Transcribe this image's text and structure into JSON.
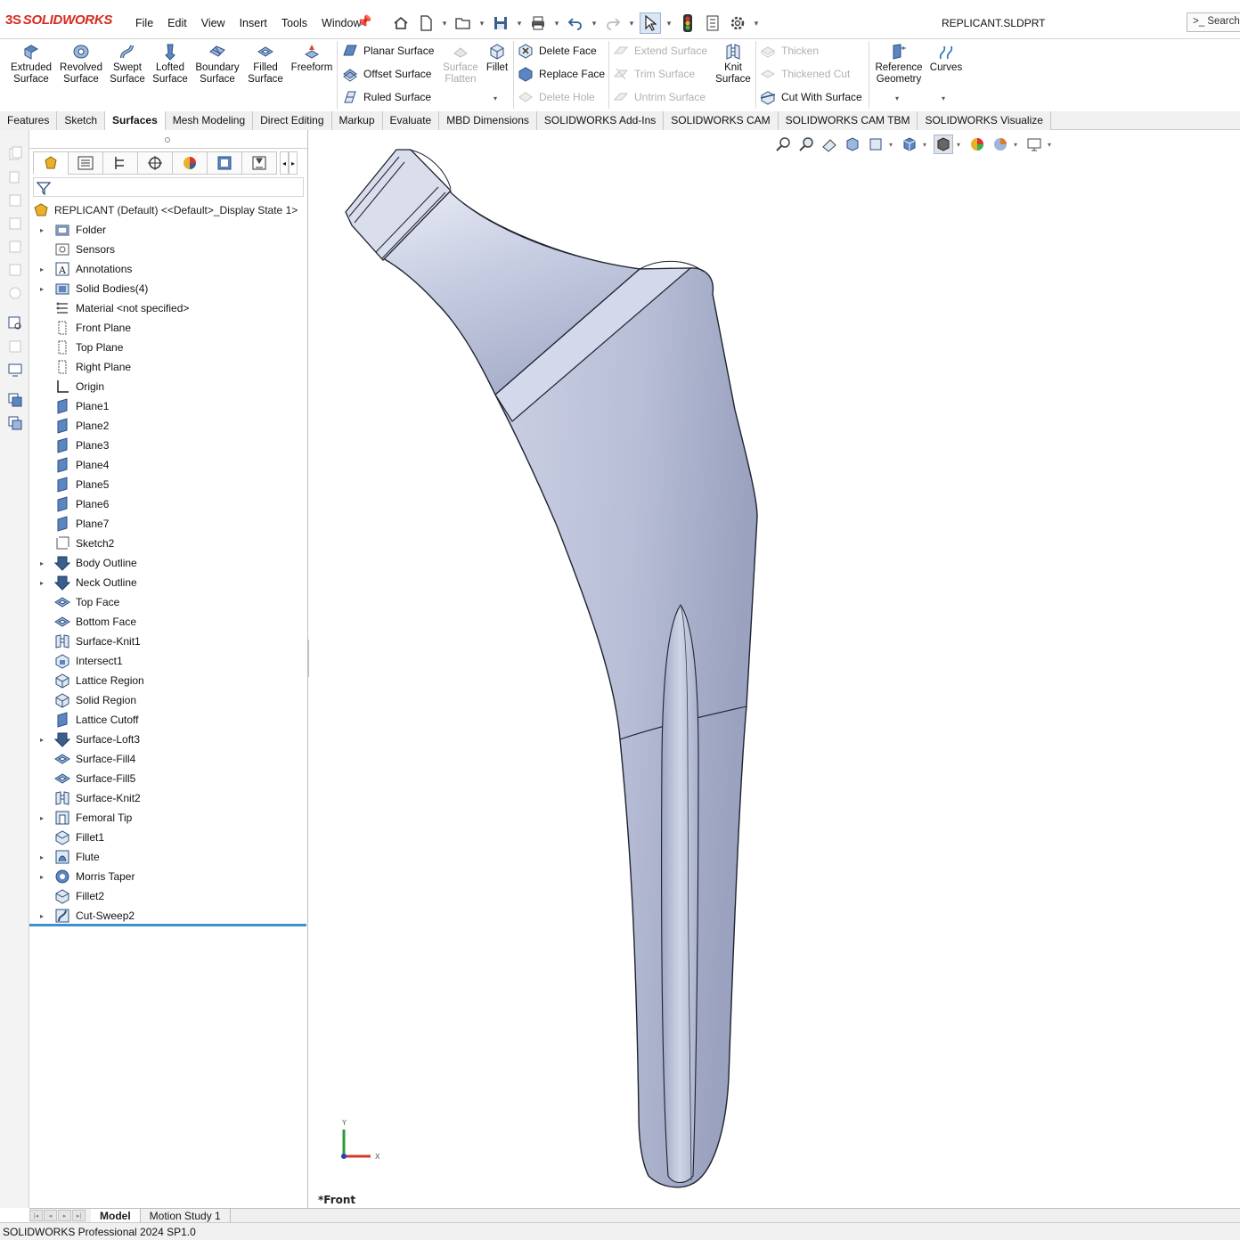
{
  "app": {
    "brand": "SOLIDWORKS",
    "brand_prefix": "3S",
    "document_title": "REPLICANT.SLDPRT",
    "search_label": "Search"
  },
  "menu": [
    "File",
    "Edit",
    "View",
    "Insert",
    "Tools",
    "Window"
  ],
  "command_manager": {
    "big_buttons": [
      {
        "label": "Extruded Surface",
        "line1": "Extruded",
        "line2": "Surface",
        "icon": "extruded-surface-icon"
      },
      {
        "label": "Revolved Surface",
        "line1": "Revolved",
        "line2": "Surface",
        "icon": "revolved-surface-icon"
      },
      {
        "label": "Swept Surface",
        "line1": "Swept",
        "line2": "Surface",
        "icon": "swept-surface-icon"
      },
      {
        "label": "Lofted Surface",
        "line1": "Lofted",
        "line2": "Surface",
        "icon": "lofted-surface-icon"
      },
      {
        "label": "Boundary Surface",
        "line1": "Boundary",
        "line2": "Surface",
        "icon": "boundary-surface-icon"
      },
      {
        "label": "Filled Surface",
        "line1": "Filled",
        "line2": "Surface",
        "icon": "filled-surface-icon"
      },
      {
        "label": "Freeform",
        "line1": "Freeform",
        "line2": "",
        "icon": "freeform-icon"
      }
    ],
    "group1": [
      "Planar Surface",
      "Offset Surface",
      "Ruled Surface"
    ],
    "surface_flatten": {
      "line1": "Surface",
      "line2": "Flatten",
      "enabled": false
    },
    "fillet": {
      "line1": "Fillet"
    },
    "group2": [
      {
        "label": "Delete Face",
        "enabled": true
      },
      {
        "label": "Replace Face",
        "enabled": true
      },
      {
        "label": "Delete Hole",
        "enabled": false
      }
    ],
    "group3": [
      {
        "label": "Extend Surface",
        "enabled": false
      },
      {
        "label": "Trim Surface",
        "enabled": false
      },
      {
        "label": "Untrim Surface",
        "enabled": false
      }
    ],
    "knit_surface": {
      "line1": "Knit",
      "line2": "Surface"
    },
    "group4": [
      {
        "label": "Thicken",
        "enabled": false
      },
      {
        "label": "Thickened Cut",
        "enabled": false
      },
      {
        "label": "Cut With Surface",
        "enabled": true
      }
    ],
    "reference_geometry": {
      "line1": "Reference",
      "line2": "Geometry"
    },
    "curves": {
      "line1": "Curves"
    }
  },
  "tabs": [
    {
      "label": "Features",
      "active": false
    },
    {
      "label": "Sketch",
      "active": false
    },
    {
      "label": "Surfaces",
      "active": true
    },
    {
      "label": "Mesh Modeling",
      "active": false
    },
    {
      "label": "Direct Editing",
      "active": false
    },
    {
      "label": "Markup",
      "active": false
    },
    {
      "label": "Evaluate",
      "active": false
    },
    {
      "label": "MBD Dimensions",
      "active": false
    },
    {
      "label": "SOLIDWORKS Add-Ins",
      "active": false
    },
    {
      "label": "SOLIDWORKS CAM",
      "active": false
    },
    {
      "label": "SOLIDWORKS CAM TBM",
      "active": false
    },
    {
      "label": "SOLIDWORKS Visualize",
      "active": false
    }
  ],
  "feature_tree": {
    "root": "REPLICANT (Default) <<Default>_Display State 1>",
    "items": [
      {
        "label": "Folder",
        "expandable": true,
        "icon": "folder-icon"
      },
      {
        "label": "Sensors",
        "expandable": false,
        "icon": "sensors-icon"
      },
      {
        "label": "Annotations",
        "expandable": true,
        "icon": "annotations-icon"
      },
      {
        "label": "Solid Bodies(4)",
        "expandable": true,
        "icon": "solid-bodies-icon"
      },
      {
        "label": "Material <not specified>",
        "expandable": false,
        "icon": "material-icon"
      },
      {
        "label": "Front Plane",
        "expandable": false,
        "icon": "plane-icon"
      },
      {
        "label": "Top Plane",
        "expandable": false,
        "icon": "plane-icon"
      },
      {
        "label": "Right Plane",
        "expandable": false,
        "icon": "plane-icon"
      },
      {
        "label": "Origin",
        "expandable": false,
        "icon": "origin-icon"
      },
      {
        "label": "Plane1",
        "expandable": false,
        "icon": "ref-plane-icon"
      },
      {
        "label": "Plane2",
        "expandable": false,
        "icon": "ref-plane-icon"
      },
      {
        "label": "Plane3",
        "expandable": false,
        "icon": "ref-plane-icon"
      },
      {
        "label": "Plane4",
        "expandable": false,
        "icon": "ref-plane-icon"
      },
      {
        "label": "Plane5",
        "expandable": false,
        "icon": "ref-plane-icon"
      },
      {
        "label": "Plane6",
        "expandable": false,
        "icon": "ref-plane-icon"
      },
      {
        "label": "Plane7",
        "expandable": false,
        "icon": "ref-plane-icon"
      },
      {
        "label": "Sketch2",
        "expandable": false,
        "icon": "sketch-icon"
      },
      {
        "label": "Body Outline",
        "expandable": true,
        "icon": "folder-down-icon"
      },
      {
        "label": "Neck Outline",
        "expandable": true,
        "icon": "folder-down-icon"
      },
      {
        "label": "Top Face",
        "expandable": false,
        "icon": "fill-surface-icon"
      },
      {
        "label": "Bottom Face",
        "expandable": false,
        "icon": "fill-surface-icon"
      },
      {
        "label": "Surface-Knit1",
        "expandable": false,
        "icon": "knit-icon"
      },
      {
        "label": "Intersect1",
        "expandable": false,
        "icon": "intersect-icon"
      },
      {
        "label": "Lattice Region",
        "expandable": false,
        "icon": "solid-feature-icon"
      },
      {
        "label": "Solid Region",
        "expandable": false,
        "icon": "solid-feature-icon"
      },
      {
        "label": "Lattice Cutoff",
        "expandable": false,
        "icon": "ref-plane-icon"
      },
      {
        "label": "Surface-Loft3",
        "expandable": true,
        "icon": "folder-down-icon"
      },
      {
        "label": "Surface-Fill4",
        "expandable": false,
        "icon": "fill-surface-icon"
      },
      {
        "label": "Surface-Fill5",
        "expandable": false,
        "icon": "fill-surface-icon"
      },
      {
        "label": "Surface-Knit2",
        "expandable": false,
        "icon": "knit-icon"
      },
      {
        "label": "Femoral Tip",
        "expandable": true,
        "icon": "part-feature-icon"
      },
      {
        "label": "Fillet1",
        "expandable": false,
        "icon": "fillet-icon"
      },
      {
        "label": "Flute",
        "expandable": true,
        "icon": "cut-icon"
      },
      {
        "label": "Morris Taper",
        "expandable": true,
        "icon": "revolve-icon"
      },
      {
        "label": "Fillet2",
        "expandable": false,
        "icon": "fillet-icon"
      },
      {
        "label": "Cut-Sweep2",
        "expandable": true,
        "icon": "cut-sweep-icon"
      }
    ]
  },
  "viewport": {
    "view_name": "*Front",
    "triad": {
      "y": "Y",
      "x": "X"
    }
  },
  "bottom_tabs": [
    {
      "label": "Model",
      "active": true
    },
    {
      "label": "Motion Study 1",
      "active": false
    }
  ],
  "status": {
    "text": "SOLIDWORKS Professional 2024 SP1.0"
  },
  "colors": {
    "brand_red": "#d52b1e",
    "part_body": "#c5cbe0",
    "accent_blue": "#3d8fcf"
  }
}
